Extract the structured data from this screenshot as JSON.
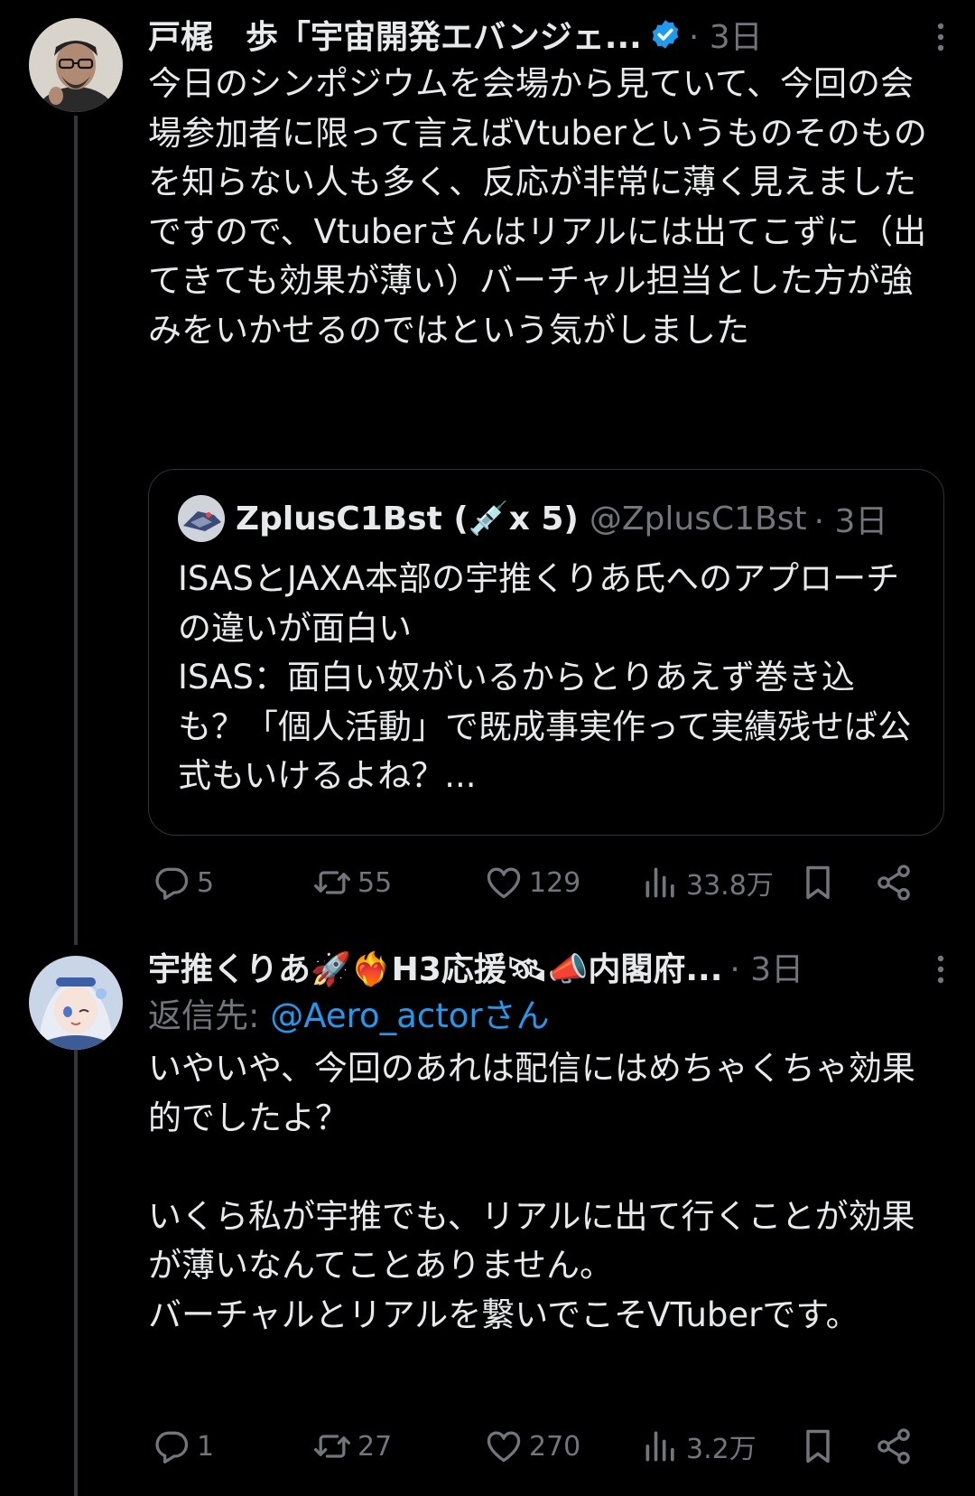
{
  "tweets": [
    {
      "display_name": "戸梶　歩「宇宙開発エバンジェ...",
      "verified": true,
      "time": "· 3日",
      "body": "今日のシンポジウムを会場から見ていて、今回の会場参加者に限って言えばVtuberというものそのものを知らない人も多く、反応が非常に薄く見えました\nですので、Vtuberさんはリアルには出てこずに（出てきても効果が薄い）バーチャル担当とした方が強みをいかせるのではという気がしました",
      "quote": {
        "name": "ZplusC1Bst (💉x 5)",
        "handle": "@ZplusC1Bst",
        "time": "· 3日",
        "body": "ISASとJAXA本部の宇推くりあ氏へのアプローチの違いが面白い\nISAS：面白い奴がいるからとりあえず巻き込も？「個人活動」で既成事実作って実績残せば公式もいけるよね？..."
      },
      "actions": {
        "replies": "5",
        "reposts": "55",
        "likes": "129",
        "views": "33.8万"
      }
    },
    {
      "display_name": "宇推くりあ🚀❤️‍🔥H3応援🛰📣内閣府...",
      "verified": false,
      "time": "· 3日",
      "reply_prefix": "返信先: ",
      "reply_handle": "@Aero_actorさん",
      "body": "いやいや、今回のあれは配信にはめちゃくちゃ効果的でしたよ？\n\nいくら私が宇推でも、リアルに出て行くことが効果が薄いなんてことありません。\nバーチャルとリアルを繋いでこそVTuberです。",
      "actions": {
        "replies": "1",
        "reposts": "27",
        "likes": "270",
        "views": "3.2万"
      }
    }
  ],
  "colors": {
    "background": "#000000",
    "text": "#e7e9ea",
    "secondary": "#71767b",
    "accent": "#1d9bf0",
    "border": "#2f3336"
  },
  "icons": {
    "reply": "reply-icon",
    "repost": "repost-icon",
    "like": "heart-icon",
    "views": "views-icon",
    "bookmark": "bookmark-icon",
    "share": "share-icon",
    "more": "more-icon",
    "verified": "verified-badge-icon"
  }
}
